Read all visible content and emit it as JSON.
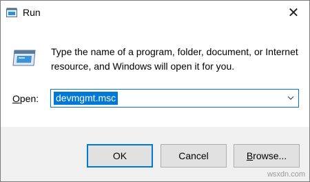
{
  "window": {
    "title": "Run",
    "close_glyph": "✕"
  },
  "dialog": {
    "description": "Type the name of a program, folder, document, or Internet resource, and Windows will open it for you.",
    "open_label_prefix": "",
    "open_label_accel": "O",
    "open_label_rest": "pen:",
    "open_value": "devmgmt.msc"
  },
  "buttons": {
    "ok": "OK",
    "cancel": "Cancel",
    "browse_accel": "B",
    "browse_rest": "rowse..."
  },
  "watermark": "wsxdn.com",
  "colors": {
    "accent": "#0078d7",
    "footer_bg": "#f0f0f0",
    "button_bg": "#e1e1e1"
  },
  "icons": {
    "app": "run-app-icon",
    "close": "close-icon",
    "dialog": "run-program-icon",
    "dropdown": "chevron-down-icon"
  }
}
